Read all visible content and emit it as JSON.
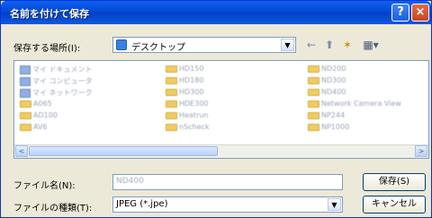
{
  "window": {
    "title": "名前を付けて保存",
    "help_label": "?",
    "close_label": "×"
  },
  "location": {
    "label": "保存する場所(I):",
    "value": "デスクトップ"
  },
  "toolbar": {
    "back": "←",
    "up": "⬆",
    "new_folder": "✶",
    "views": "▦▾"
  },
  "files": {
    "col1": [
      "マイ ドキュメント",
      "マイ コンピュータ",
      "マイ ネットワーク",
      "A065",
      "AD100",
      "AV6"
    ],
    "col2": [
      "HD150",
      "HD180",
      "HD300",
      "HDE300",
      "Heatrun",
      "nScheck"
    ],
    "col3": [
      "ND200",
      "ND300",
      "ND400",
      "Network Camera View",
      "NP244",
      "NP1000"
    ]
  },
  "filename": {
    "label": "ファイル名(N):",
    "value": "ND400"
  },
  "filetype": {
    "label": "ファイルの種類(T):",
    "value": "JPEG (*.jpe)"
  },
  "buttons": {
    "save": "保存(S)",
    "cancel": "キャンセル"
  },
  "scroll": {
    "left": "<",
    "right": ">"
  }
}
